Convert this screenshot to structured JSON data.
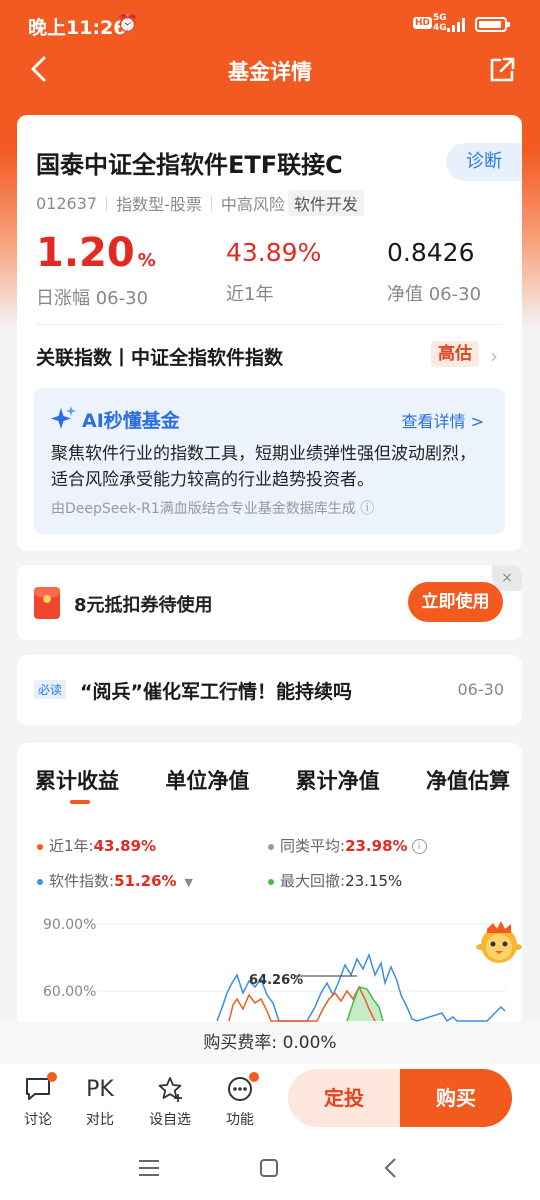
{
  "status": {
    "time": "晚上11:26",
    "hd": "HD",
    "net": "5G",
    "net_sub": "4G"
  },
  "nav": {
    "title": "基金详情"
  },
  "fund": {
    "name": "国泰中证全指软件ETF联接C",
    "diagnose": "诊断",
    "code": "012637",
    "type": "指数型-股票",
    "risk": "中高风险",
    "sector": "软件开发",
    "daily_change": "1.20",
    "daily_change_unit": "%",
    "daily_change_label": "日涨幅 06-30",
    "year_return": "43.89%",
    "year_return_label": "近1年",
    "nav_value": "0.8426",
    "nav_label": "净值 06-30",
    "index_label": "关联指数丨中证全指软件指数",
    "valuation": "高估"
  },
  "ai": {
    "title": "AI秒懂基金",
    "more": "查看详情 >",
    "text": "聚焦软件行业的指数工具，短期业绩弹性强但波动剧烈，适合风险承受能力较高的行业趋势投资者。",
    "source": "由DeepSeek-R1满血版结合专业基金数据库生成 ⓘ"
  },
  "coupon": {
    "text": "8元抵扣券待使用",
    "button": "立即使用",
    "close": "×"
  },
  "news": {
    "tag": "必读",
    "title": "“阅兵”催化军工行情！能持续吗",
    "date": "06-30"
  },
  "chart": {
    "tabs": [
      "累计收益",
      "单位净值",
      "累计净值",
      "净值估算"
    ],
    "legend": [
      {
        "label": "近1年:",
        "value": "43.89%",
        "color": "#f25a1e"
      },
      {
        "label": "同类平均:",
        "value": "23.98%",
        "color": "#999999"
      },
      {
        "label": "软件指数:",
        "value": "51.26%",
        "color": "#3a8ee6"
      },
      {
        "label": "最大回撤:",
        "value": "23.15%",
        "color": "#4cb84c"
      }
    ],
    "y_ticks": [
      "90.00%",
      "60.00%"
    ],
    "peak_label": "64.26%"
  },
  "chart_data": {
    "type": "line",
    "title": "",
    "yticks": [
      "90.00%",
      "60.00%"
    ],
    "series": [
      {
        "name": "近1年",
        "final_value": 43.89,
        "peak": 64.26
      },
      {
        "name": "同类平均",
        "final_value": 23.98
      },
      {
        "name": "软件指数",
        "final_value": 51.26
      },
      {
        "name": "最大回撤",
        "final_value": 23.15
      }
    ],
    "annotations": [
      "64.26%"
    ]
  },
  "fee": {
    "label": "购买费率:",
    "value": "0.00%"
  },
  "bottom": {
    "items": [
      {
        "label": "讨论"
      },
      {
        "label": "对比",
        "icon_text": "PK"
      },
      {
        "label": "设自选"
      },
      {
        "label": "功能"
      }
    ],
    "sip": "定投",
    "buy": "购买"
  }
}
